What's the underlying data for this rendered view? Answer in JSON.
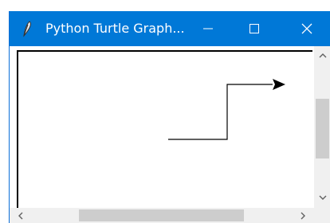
{
  "window": {
    "title": "Python Turtle Graph...",
    "icons": {
      "app": "feather-icon",
      "minimize": "minimize-icon",
      "maximize": "maximize-icon",
      "close": "close-icon"
    }
  },
  "canvas": {
    "content": "turtle path with arrow cursor",
    "cursor_icon": "turtle-arrow-icon"
  },
  "scrollbars": {
    "vertical": {
      "up_icon": "chevron-up-icon",
      "down_icon": "chevron-down-icon"
    },
    "horizontal": {
      "left_icon": "chevron-left-icon",
      "right_icon": "chevron-right-icon"
    }
  },
  "colors": {
    "titlebar": "#0078d7",
    "scrollbar_track": "#f0f0f0",
    "scrollbar_thumb": "#cdcdcd",
    "ink": "#000000"
  }
}
